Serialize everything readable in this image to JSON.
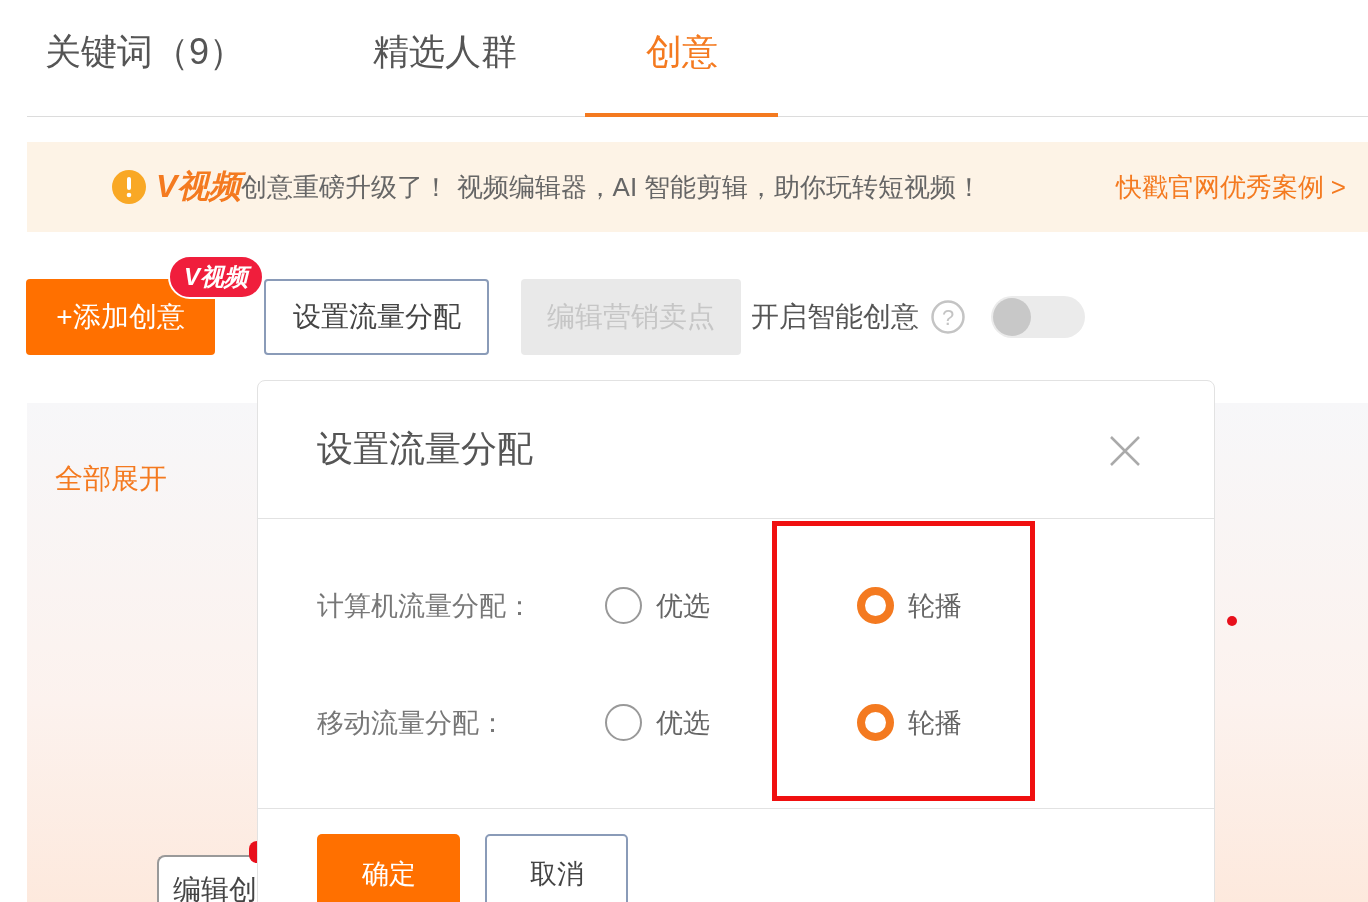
{
  "tabs": [
    {
      "label": "关键词（9）",
      "selected": false
    },
    {
      "label": "精选人群",
      "selected": false
    },
    {
      "label": "创意",
      "selected": true
    }
  ],
  "banner": {
    "brand": "V视频",
    "message": "创意重磅升级了！ 视频编辑器，AI 智能剪辑，助你玩转短视频！",
    "link": "快戳官网优秀案例 >"
  },
  "toolbar": {
    "add_button": "+添加创意",
    "badge": "V视频",
    "traffic_button": "设置流量分配",
    "selling_point_button": {
      "label": "编辑营销卖点",
      "disabled": true
    },
    "smart_creative": {
      "label": "开启智能创意",
      "help": "?",
      "on": false
    }
  },
  "panel": {
    "expand_all": "全部展开",
    "edit_button": "编辑创"
  },
  "dialog": {
    "title": "设置流量分配",
    "rows": [
      {
        "label": "计算机流量分配：",
        "options": [
          {
            "label": "优选",
            "selected": false
          },
          {
            "label": "轮播",
            "selected": true
          }
        ]
      },
      {
        "label": "移动流量分配：",
        "options": [
          {
            "label": "优选",
            "selected": false
          },
          {
            "label": "轮播",
            "selected": true
          }
        ]
      }
    ],
    "confirm": "确定",
    "cancel": "取消"
  }
}
